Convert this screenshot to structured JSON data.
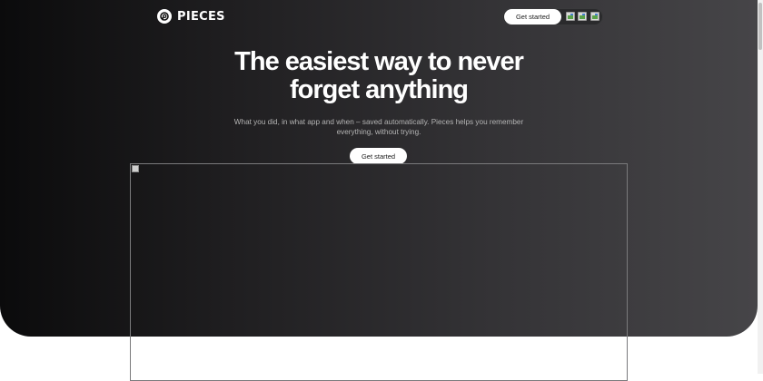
{
  "brand": {
    "name": "PIECES",
    "logo_icon": "pieces-logo-icon"
  },
  "nav": {
    "cta_label": "Get started",
    "icons": [
      "image-icon",
      "image-icon",
      "image-icon"
    ]
  },
  "hero": {
    "headline_line1": "The easiest way to never",
    "headline_line2": "forget anything",
    "subtext_line1": "What you did, in what app and when – saved automatically. Pieces helps you remember",
    "subtext_line2": "everything, without trying.",
    "cta_label": "Get started"
  },
  "colors": {
    "hero_gradient_start": "#0b0b0c",
    "hero_gradient_end": "#464548",
    "cta_background": "#ffffff",
    "page_background": "#ffffff"
  }
}
